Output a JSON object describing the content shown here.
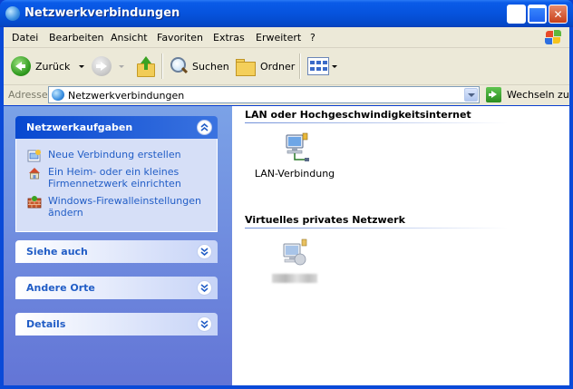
{
  "window": {
    "title": "Netzwerkverbindungen",
    "min_label": "",
    "max_label": "",
    "close_label": "✕"
  },
  "menu": [
    "Datei",
    "Bearbeiten",
    "Ansicht",
    "Favoriten",
    "Extras",
    "Erweitert",
    "?"
  ],
  "toolbar": {
    "back_label": "Zurück",
    "search_label": "Suchen",
    "folders_label": "Ordner"
  },
  "address": {
    "label": "Adresse",
    "value": "Netzwerkverbindungen",
    "go_label": "Wechseln zu"
  },
  "left_panels": {
    "tasks": {
      "title": "Netzwerkaufgaben",
      "items": [
        {
          "label": "Neue Verbindung erstellen",
          "icon": "new-connection-icon"
        },
        {
          "label": "Ein Heim- oder ein kleines Firmennetzwerk einrichten",
          "icon": "home-network-icon"
        },
        {
          "label": "Windows-Firewalleinstellungen ändern",
          "icon": "firewall-icon"
        }
      ]
    },
    "see_also": {
      "title": "Siehe auch"
    },
    "other_places": {
      "title": "Andere Orte"
    },
    "details": {
      "title": "Details"
    }
  },
  "groups": [
    {
      "heading": "LAN oder Hochgeschwindigkeitsinternet",
      "items": [
        {
          "label": "LAN-Verbindung",
          "icon": "lan-connection-icon"
        }
      ]
    },
    {
      "heading": "Virtuelles privates Netzwerk",
      "items": [
        {
          "label": "",
          "icon": "vpn-connection-icon"
        }
      ]
    }
  ],
  "colors": {
    "title_bar": "#0653dd",
    "link_blue": "#215dc6",
    "task_pane_bg": "#7ba2e7",
    "panel_body": "#d6dff7"
  }
}
